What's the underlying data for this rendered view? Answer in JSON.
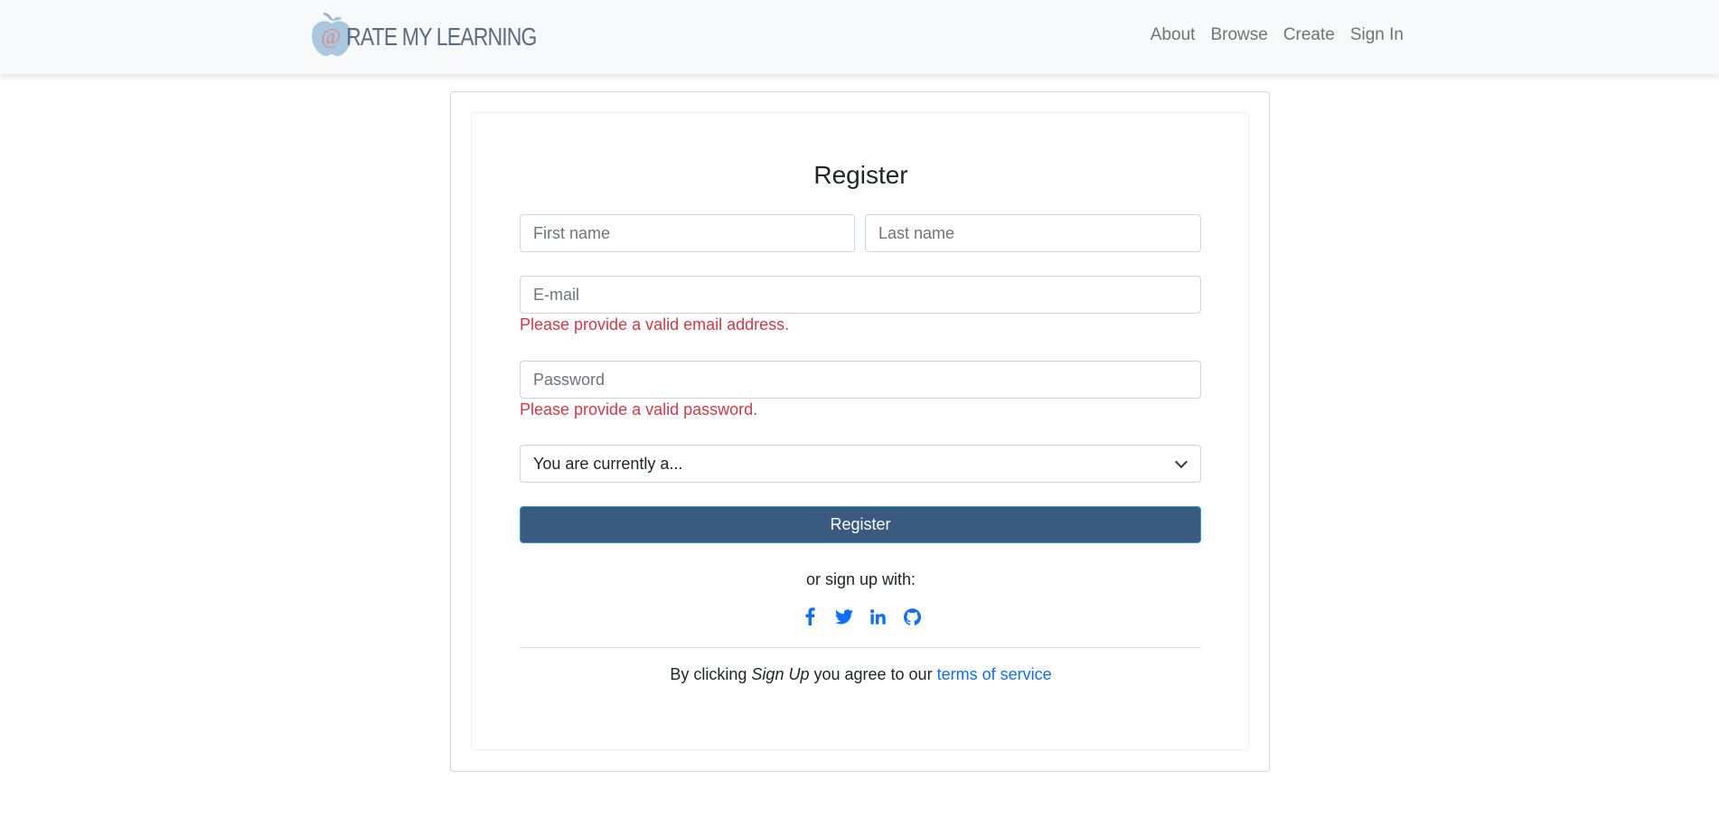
{
  "navbar": {
    "brand_text": "RATE MY LEARNING",
    "brand_logo_glyph": "@",
    "links": [
      "About",
      "Browse",
      "Create",
      "Sign In"
    ]
  },
  "form": {
    "title": "Register",
    "first_name_placeholder": "First name",
    "last_name_placeholder": "Last name",
    "email_placeholder": "E-mail",
    "email_error": "Please provide a valid email address.",
    "password_placeholder": "Password",
    "password_error": "Please provide a valid password.",
    "role_select_value": "You are currently a...",
    "submit_label": "Register",
    "social_prompt": "or sign up with:",
    "social_icons": [
      "facebook-icon",
      "twitter-icon",
      "linkedin-icon",
      "github-icon"
    ],
    "terms_prefix": "By clicking ",
    "terms_emphasis": "Sign Up",
    "terms_middle": " you agree to our ",
    "terms_link": "terms of service"
  },
  "colors": {
    "primary_button": "#3a5a80",
    "error": "#dc3545",
    "link": "#0d6efd",
    "brand_text": "#5a6c85",
    "navbar_bg": "#f8f9fa"
  }
}
